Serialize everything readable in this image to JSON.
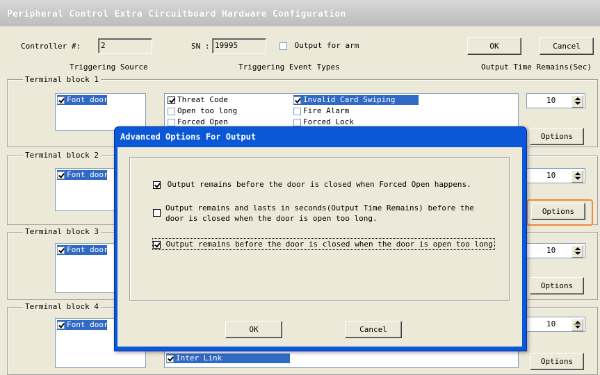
{
  "window": {
    "title": "Peripheral Control Extra Circuitboard Hardware Configuration"
  },
  "top": {
    "controller_label": "Controller #:",
    "controller_value": "2",
    "sn_label": "SN :",
    "sn_value": "19995",
    "output_for_arm": "Output for arm",
    "ok": "OK",
    "cancel": "Cancel"
  },
  "headers": {
    "source": "Triggering Source",
    "events": "Triggering Event Types",
    "time": "Output Time Remains(Sec)"
  },
  "blocks": [
    {
      "label": "Terminal block 1",
      "source": "Font door",
      "time": "10",
      "options": "Options"
    },
    {
      "label": "Terminal block 2",
      "source": "Font door",
      "time": "10",
      "options": "Options"
    },
    {
      "label": "Terminal block 3",
      "source": "Font door",
      "time": "10",
      "options": "Options"
    },
    {
      "label": "Terminal block 4",
      "source": "Font door",
      "time": "10",
      "options": "Options"
    }
  ],
  "events1": {
    "threat_code": "Threat Code",
    "invalid_card": "Invalid Card Swiping",
    "open_too_long": "Open too long",
    "fire_alarm": "Fire Alarm",
    "forced_open": "Forced Open",
    "forced_lock": "Forced Lock"
  },
  "events4": {
    "inter_link": "Inter Link"
  },
  "dialog": {
    "title": "Advanced Options For Output",
    "opt1": "Output remains before the door is closed when Forced Open happens.",
    "opt2_line1": "Output remains and lasts in seconds(Output Time Remains) before the",
    "opt2_line2": "door is closed when the door is open too long.",
    "opt3": "Output remains before the door is closed when the door is open too long",
    "ok": "OK",
    "cancel": "Cancel"
  },
  "colors": {
    "selection": "#316ac5",
    "dialog_title": "#0a57d8",
    "highlight_border": "#f0883c"
  }
}
